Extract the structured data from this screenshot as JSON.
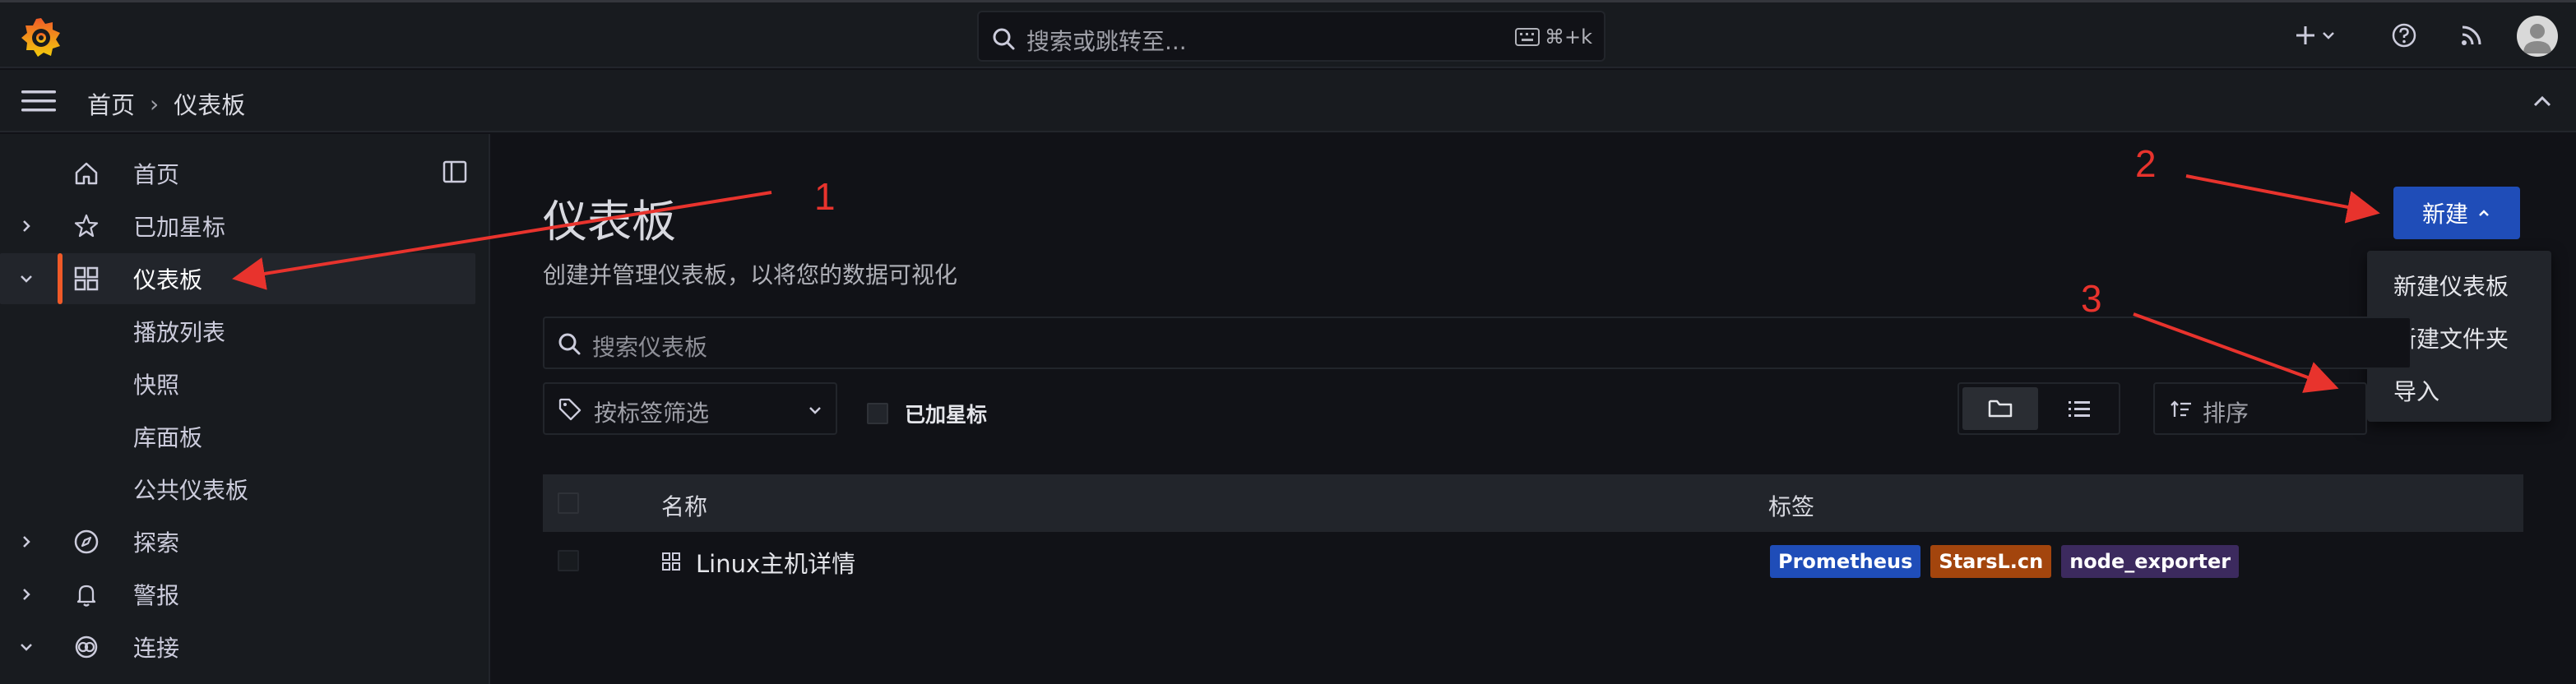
{
  "topbar": {
    "search_placeholder": "搜索或跳转至...",
    "search_shortcut": "⌘+k",
    "plus_label": "+",
    "icons": [
      "grafana-logo",
      "search-icon",
      "keyboard-icon",
      "plus-icon",
      "chevron-down-icon",
      "help-icon",
      "rss-icon",
      "avatar"
    ]
  },
  "breadcrumb": {
    "items": [
      "首页",
      "仪表板"
    ],
    "separator": "›"
  },
  "sidebar": {
    "items": [
      {
        "label": "首页",
        "icon": "home-icon"
      },
      {
        "label": "已加星标",
        "icon": "star-icon",
        "expand": "collapsed"
      },
      {
        "label": "仪表板",
        "icon": "apps-icon",
        "expand": "expanded",
        "active": true
      },
      {
        "label": "播放列表"
      },
      {
        "label": "快照"
      },
      {
        "label": "库面板"
      },
      {
        "label": "公共仪表板"
      },
      {
        "label": "探索",
        "icon": "compass-icon",
        "expand": "collapsed"
      },
      {
        "label": "警报",
        "icon": "bell-icon",
        "expand": "collapsed"
      },
      {
        "label": "连接",
        "icon": "link-icon",
        "expand": "expanded"
      }
    ]
  },
  "main": {
    "title": "仪表板",
    "subtitle": "创建并管理仪表板，以将您的数据可视化",
    "new_button": "新建",
    "new_menu": [
      "新建仪表板",
      "新建文件夹",
      "导入"
    ],
    "search_placeholder": "搜索仪表板",
    "tag_filter_placeholder": "按标签筛选",
    "starred_label": "已加星标",
    "sort_placeholder": "排序",
    "table": {
      "headers": {
        "name": "名称",
        "tags": "标签"
      },
      "rows": [
        {
          "name": "Linux主机详情",
          "tags": [
            "Prometheus",
            "StarsL.cn",
            "node_exporter"
          ]
        }
      ]
    }
  },
  "tag_colors": {
    "Prometheus": "#1f4db8",
    "StarsL.cn": "#a3450d",
    "node_exporter": "#3c2a5e"
  },
  "annotations": [
    "1",
    "2",
    "3"
  ],
  "colors": {
    "accent": "#f05a28",
    "primary": "#1f4db8",
    "annotation": "#e8332d"
  }
}
